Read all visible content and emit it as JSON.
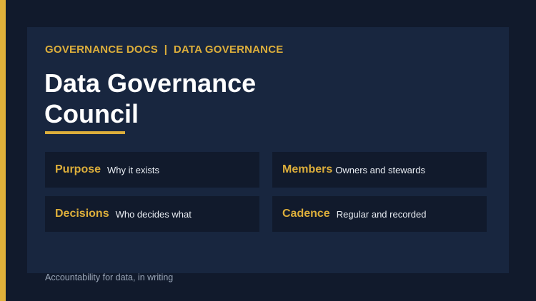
{
  "header": {
    "eyebrow": "GOVERNANCE DOCS  |  DATA GOVERNANCE",
    "title": "Data Governance Council"
  },
  "cards": [
    {
      "label": "Purpose",
      "description": "Why it exists"
    },
    {
      "label": "Members",
      "description": "Owners and stewards"
    },
    {
      "label": "Decisions",
      "description": "Who decides what"
    },
    {
      "label": "Cadence",
      "description": "Regular and recorded"
    }
  ],
  "footer": {
    "text": "Accountability for data, in writing"
  },
  "colors": {
    "background": "#111a2c",
    "panel": "#18263f",
    "accent": "#dcae3b",
    "title": "#ffffff",
    "muted": "#9aa6b8"
  }
}
